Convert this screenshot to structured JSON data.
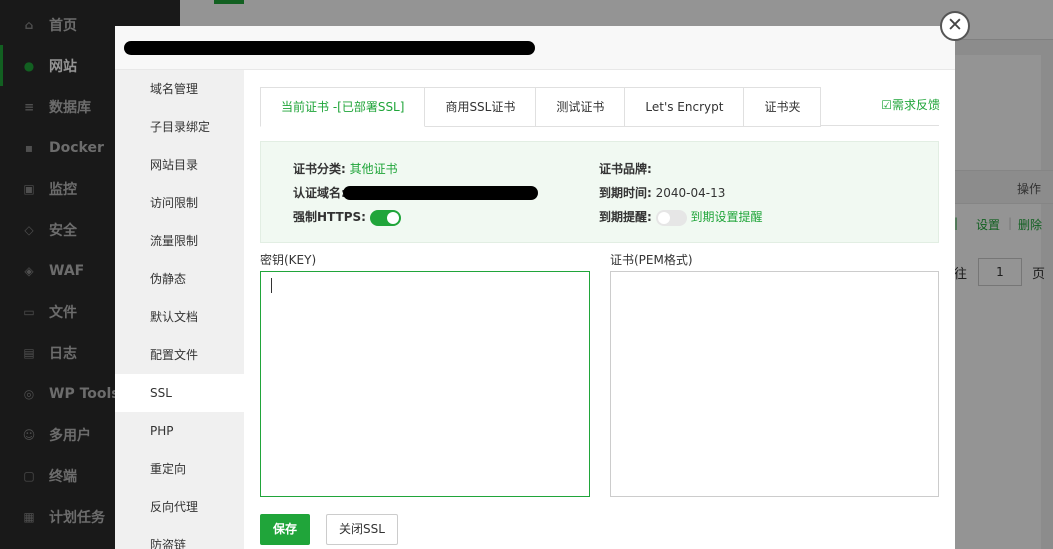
{
  "sidebar": {
    "items": [
      {
        "label": "首页",
        "icon": "home-icon"
      },
      {
        "label": "网站",
        "icon": "globe-icon"
      },
      {
        "label": "数据库",
        "icon": "database-icon"
      },
      {
        "label": "Docker",
        "icon": "docker-icon"
      },
      {
        "label": "监控",
        "icon": "monitor-icon"
      },
      {
        "label": "安全",
        "icon": "shield-icon"
      },
      {
        "label": "WAF",
        "icon": "waf-shield-icon"
      },
      {
        "label": "文件",
        "icon": "folder-icon"
      },
      {
        "label": "日志",
        "icon": "log-icon"
      },
      {
        "label": "WP Tools",
        "icon": "wordpress-icon"
      },
      {
        "label": "多用户",
        "icon": "users-icon"
      },
      {
        "label": "终端",
        "icon": "terminal-icon"
      },
      {
        "label": "计划任务",
        "icon": "calendar-icon"
      }
    ]
  },
  "background": {
    "table_header_action": "操作",
    "row_actions": [
      "设置",
      "删除"
    ],
    "pager_prefix": "往",
    "pager_value": "1",
    "pager_suffix": "页"
  },
  "dialog": {
    "close_symbol": "✕",
    "side_items": [
      "域名管理",
      "子目录绑定",
      "网站目录",
      "访问限制",
      "流量限制",
      "伪静态",
      "默认文档",
      "配置文件",
      "SSL",
      "PHP",
      "重定向",
      "反向代理",
      "防盗链"
    ],
    "active_side": "SSL",
    "tabs": [
      "当前证书 -[已部署SSL]",
      "商用SSL证书",
      "测试证书",
      "Let's Encrypt",
      "证书夹"
    ],
    "feedback": "需求反馈",
    "info": {
      "category_label": "证书分类:",
      "category_value": "其他证书",
      "brand_label": "证书品牌:",
      "brand_value": "",
      "domain_label": "认证域名:",
      "expiry_label": "到期时间:",
      "expiry_value": "2040-04-13",
      "https_label": "强制HTTPS:",
      "https_enabled": true,
      "reminder_label": "到期提醒:",
      "reminder_enabled": false,
      "reminder_link": "到期设置提醒"
    },
    "key_label": "密钥(KEY)",
    "key_value": "",
    "cert_label": "证书(PEM格式)",
    "cert_value": "",
    "save_label": "保存",
    "close_ssl_label": "关闭SSL"
  },
  "colors": {
    "accent": "#20a53a",
    "sidebar_bg": "#2c2c2c"
  }
}
